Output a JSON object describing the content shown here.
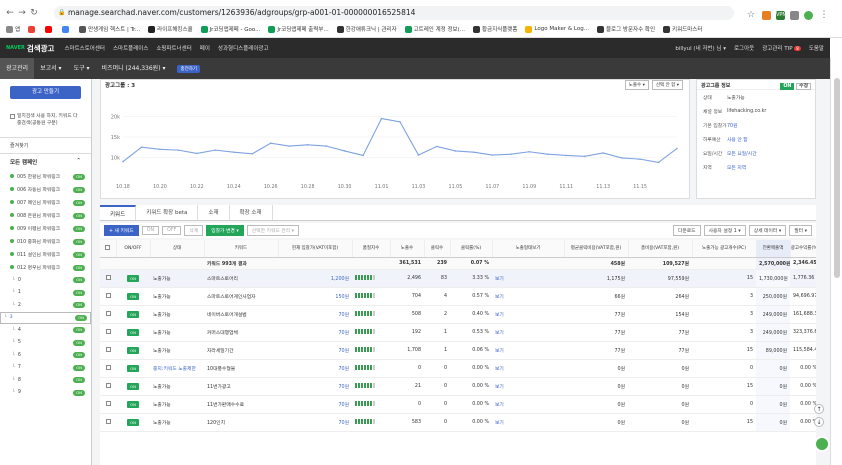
{
  "browser": {
    "url": "manage.searchad.naver.com/customers/1263936/adgroups/grp-a001-01-000000016525814",
    "bookmarks": [
      "앱",
      "",
      "",
      "",
      "만생게임 헥스트 | Tr...",
      "라이프해킹스쿨",
      "Jr코딩앱제페 - Goo...",
      "Jr코딩앱제페 출력부...",
      "한강애튜크닉 | 관리자",
      "고트레인 계정 정보(...",
      "황금지식플랫폼",
      "Logo Maker & Log...",
      "블로그 방문자수 확인",
      "키워드마스터"
    ],
    "ext_badge": "VPN"
  },
  "topnav": {
    "brand": "검색광고",
    "brand_logo": "NAVER",
    "menus": [
      "스마트스토어센터",
      "스마트플레이스",
      "쇼핑파트너센터",
      "페이",
      "성과형디스플레이광고"
    ],
    "right": [
      "billyul (네 저번) 님 ▾",
      "로그아웃",
      "광고관리 TIP",
      "도움말"
    ],
    "tip_badge": "8"
  },
  "subnav": {
    "items": [
      "광고관리",
      "보고서 ▾",
      "도구 ▾",
      "비즈머니 (244,336원) ▾"
    ],
    "charge": "충전하기"
  },
  "sidebar": {
    "new_ad": "광고 만들기",
    "option_text": "일치검색 사용 하지, 키워드 다중검색(공통원 구분)",
    "favorites": "즐겨찾기",
    "campaign_header": "모든 캠페인",
    "groups": [
      {
        "label": "005 한왈님 파워링크",
        "pill": "ON"
      },
      {
        "label": "006 자동님 파워링크",
        "pill": "ON"
      },
      {
        "label": "007 메인님 파워링크",
        "pill": "ON"
      },
      {
        "label": "008 은원님 파워링크",
        "pill": "ON"
      },
      {
        "label": "009 이펭님 파워링크",
        "pill": "ON"
      },
      {
        "label": "010 중화님 파워링크",
        "pill": "ON"
      },
      {
        "label": "011 설인님 파워링크",
        "pill": "ON"
      },
      {
        "label": "012 명우님 파워링크",
        "pill": "ON"
      }
    ],
    "adgroups": [
      "0",
      "1",
      "2",
      "3",
      "4",
      "5",
      "6",
      "7",
      "8",
      "9"
    ],
    "selected_adgroup": "3"
  },
  "chart": {
    "title": "광고그룹 : 3",
    "sel1": "노출수 ▾",
    "sel2": "선택 안 함 ▾"
  },
  "chart_data": {
    "type": "line",
    "x": [
      "10.18",
      "10.19",
      "10.20",
      "10.21",
      "10.22",
      "10.23",
      "10.24",
      "10.25",
      "10.26",
      "10.27",
      "10.28",
      "10.29",
      "10.30",
      "10.31",
      "11.01",
      "11.02",
      "11.03",
      "11.04",
      "11.05",
      "11.06",
      "11.07",
      "11.08",
      "11.09",
      "11.10",
      "11.11",
      "11.12",
      "11.13",
      "11.14",
      "11.15",
      "11.16",
      "11.17"
    ],
    "xticks": [
      "10.18",
      "10.20",
      "10.22",
      "10.24",
      "10.26",
      "10.28",
      "10.30",
      "11.01",
      "11.03",
      "11.05",
      "11.07",
      "11.09",
      "11.11",
      "11.13",
      "11.15"
    ],
    "values": [
      9000,
      12500,
      12000,
      11800,
      11000,
      11800,
      11300,
      10900,
      13500,
      12800,
      13100,
      12800,
      11600,
      10500,
      19500,
      18700,
      10600,
      12700,
      11600,
      11300,
      10600,
      10800,
      11400,
      10800,
      10500,
      10300,
      11100,
      9900,
      9600,
      8800,
      12200
    ],
    "yticks": [
      "20k",
      "15k",
      "10k"
    ],
    "ylim": [
      5000,
      25000
    ]
  },
  "info": {
    "title": "광고그룹 정보",
    "on_label": "ON",
    "edit": "수정",
    "rows": [
      {
        "k": "상태",
        "v": "노출가능",
        "link": false
      },
      {
        "k": "채널 정보",
        "v": "lifehacking.co.kr",
        "link": false
      },
      {
        "k": "기본 입찰가",
        "v": "70원",
        "link": true
      },
      {
        "k": "하루예산",
        "v": "사용 안 함",
        "link": true
      },
      {
        "k": "요일/시간",
        "v": "모든 요일/시간",
        "link": true
      },
      {
        "k": "지역",
        "v": "모든 지역",
        "link": true
      }
    ]
  },
  "tabs": [
    "키워드",
    "키워드 확장 beta",
    "소재",
    "확장 소재"
  ],
  "toolbar": {
    "add": "+ 새 키워드",
    "on": "ON",
    "off": "OFF",
    "del": "삭제",
    "bid": "입찰가 변경 ▾",
    "sel": "선택한 키워드 관리 ▾",
    "right": [
      "다운로드",
      "사용자 설정 1 ▾",
      "상세 데이터 ▾",
      "필터 ▾"
    ]
  },
  "table": {
    "headers": [
      "ON/OFF",
      "상태",
      "키워드",
      "현재 입찰가(VAT미포함)",
      "품질지수",
      "노출수",
      "클릭수",
      "클릭률(%)",
      "노출형태보기",
      "평균클릭비용(VAT포함,원)",
      "총비용(VAT포함,원)",
      "노출가능 광고개수(PC)",
      "전환매출액",
      "광고수익률(%)"
    ],
    "summary": {
      "label": "키워드 993개 결과",
      "imp": "361,531",
      "clk": "239",
      "ctr": "0.07 %",
      "cpc": "458원",
      "cost": "109,527원",
      "conv": "2,570,000원",
      "roas": "2,346.45 %"
    },
    "rows": [
      {
        "status": "노출가능",
        "kw": "스마트스토어리",
        "bid": "1,200원",
        "q": 6,
        "imp": "2,496",
        "clk": "83",
        "ctr": "3.33 %",
        "view": "보기",
        "cpc": "1,175원",
        "cost": "97,559원",
        "ads": "15",
        "conv": "1,730,000원",
        "roas": "1,776.36 %"
      },
      {
        "status": "노출가능",
        "kw": "스마트스토어게인사업자",
        "bid": "150원",
        "q": 6,
        "imp": "704",
        "clk": "4",
        "ctr": "0.57 %",
        "view": "보기",
        "cpc": "66원",
        "cost": "264원",
        "ads": "3",
        "conv": "250,000원",
        "roas": "94,696.97 %"
      },
      {
        "status": "노출가능",
        "kw": "네이버스토어개설법",
        "bid": "70원",
        "q": 6,
        "imp": "508",
        "clk": "2",
        "ctr": "0.40 %",
        "view": "보기",
        "cpc": "77원",
        "cost": "154원",
        "ads": "3",
        "conv": "249,000원",
        "roas": "161,688.31 %"
      },
      {
        "status": "노출가능",
        "kw": "커머스대행업체",
        "bid": "70원",
        "q": 6,
        "imp": "192",
        "clk": "1",
        "ctr": "0.53 %",
        "view": "보기",
        "cpc": "77원",
        "cost": "77원",
        "ads": "3",
        "conv": "249,000원",
        "roas": "323,376.62 %"
      },
      {
        "status": "노출가능",
        "kw": "자라세일기간",
        "bid": "70원",
        "q": 6,
        "imp": "1,708",
        "clk": "1",
        "ctr": "0.06 %",
        "view": "보기",
        "cpc": "77원",
        "cost": "77원",
        "ads": "15",
        "conv": "89,000원",
        "roas": "115,584.42 %"
      },
      {
        "status": "중지:키워드 노출제한",
        "kw": "10대풍수형물",
        "bid": "70원",
        "q": 6,
        "imp": "0",
        "clk": "0",
        "ctr": "0.00 %",
        "view": "보기",
        "cpc": "0원",
        "cost": "0원",
        "ads": "0",
        "conv": "0원",
        "roas": "0.00 %"
      },
      {
        "status": "노출가능",
        "kw": "11번가광고",
        "bid": "70원",
        "q": 6,
        "imp": "21",
        "clk": "0",
        "ctr": "0.00 %",
        "view": "보기",
        "cpc": "0원",
        "cost": "0원",
        "ads": "15",
        "conv": "0원",
        "roas": "0.00 %"
      },
      {
        "status": "노출가능",
        "kw": "11번가판매수수료",
        "bid": "70원",
        "q": 6,
        "imp": "0",
        "clk": "0",
        "ctr": "0.00 %",
        "view": "보기",
        "cpc": "0원",
        "cost": "0원",
        "ads": "0",
        "conv": "0원",
        "roas": "0.00 %"
      },
      {
        "status": "노출가능",
        "kw": "120인치",
        "bid": "70원",
        "q": 6,
        "imp": "583",
        "clk": "0",
        "ctr": "0.00 %",
        "view": "보기",
        "cpc": "0원",
        "cost": "0원",
        "ads": "15",
        "conv": "0원",
        "roas": "0.00 %"
      }
    ]
  }
}
